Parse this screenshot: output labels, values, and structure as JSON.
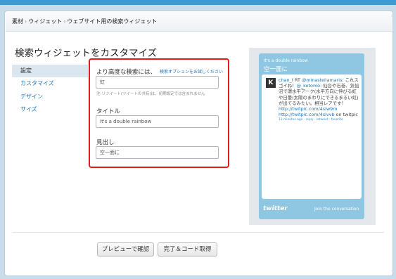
{
  "breadcrumb": {
    "items": [
      "素材",
      "ウィジェット",
      "ウェブサイト用の検索ウィジェット"
    ],
    "separator": "›"
  },
  "page": {
    "title": "検索ウィジェットをカスタマイズ"
  },
  "sidebar": {
    "items": [
      {
        "label": "設定",
        "active": true
      },
      {
        "label": "カスタマイズ",
        "active": false
      },
      {
        "label": "デザイン",
        "active": false
      },
      {
        "label": "サイズ",
        "active": false
      }
    ]
  },
  "form": {
    "query_label": "より高度な検索には、",
    "advanced_link": "検索オプションをお試しください",
    "query_value": "虹",
    "note": "注:リツイート(ツイートの共有)は、初期設定では含まれません",
    "title_label": "タイトル",
    "title_value": "It's a double rainbow",
    "caption_label": "見出し",
    "caption_value": "空一面に"
  },
  "preview": {
    "small_title": "It's a double rainbow",
    "caption": "空一面に",
    "avatar_letter": "K",
    "tweet": {
      "user": "chan_f",
      "text_1": " RT ",
      "mention_1": "@minastellamaris",
      "text_2": ": これスゴイね！",
      "mention_2": "@_kotomo",
      "text_3": ": 仙台や石巻、気仙沼で環水平アーク(水平方向に伸びる虹や日暈(太陽のまわりにできるまるい虹)が出てるみたい。相当レアです！",
      "link_1": "http://twitpic.com/4slw9m",
      "link_2": "http://twitpic.com/4slvvb",
      "text_4": " on twitpic",
      "meta": "11 minutes ago · reply · retweet · favorite"
    },
    "logo": "twitter",
    "join": "Join the conversation"
  },
  "buttons": {
    "preview": "プレビューで確認",
    "done": "完了＆コード取得"
  },
  "colors": {
    "background": "#c8dde9",
    "topbar": "#3f9ad2",
    "highlight_box": "#e51b1b",
    "link": "#2276bb",
    "widget": "#8fc6e2"
  }
}
